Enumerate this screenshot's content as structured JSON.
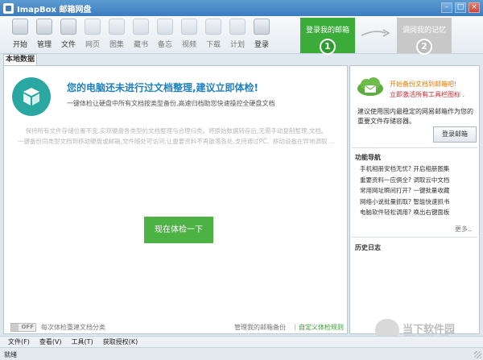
{
  "window": {
    "title": "ImapBox 邮箱网盘",
    "btn_min": "–",
    "btn_max": "□",
    "btn_close": "×"
  },
  "toolbar": {
    "items": [
      {
        "label": "开始",
        "icon": "home-icon"
      },
      {
        "label": "管理",
        "icon": "manage-icon"
      },
      {
        "label": "文件",
        "icon": "file-icon"
      },
      {
        "label": "网页",
        "icon": "webpage-icon"
      },
      {
        "label": "图集",
        "icon": "gallery-icon"
      },
      {
        "label": "藏书",
        "icon": "books-icon"
      },
      {
        "label": "备忘",
        "icon": "memo-icon"
      },
      {
        "label": "视频",
        "icon": "video-icon"
      },
      {
        "label": "下载",
        "icon": "download-icon"
      },
      {
        "label": "计划",
        "icon": "plan-icon"
      },
      {
        "label": "登录",
        "icon": "mail-server-icon"
      }
    ],
    "step1": {
      "label": "登录我的邮箱",
      "num": "1"
    },
    "step2": {
      "label": "调阅我的记忆",
      "num": "2"
    }
  },
  "tab": {
    "label": "本地数据"
  },
  "main": {
    "headline": "您的电脑还未进行过文档整理,建议立即体检!",
    "subline": "一键体检让硬盘中所有文档按类型备份,高速归档助您快速操控全硬盘文档",
    "desc_line1": "保持所有文件存储位置不变,实现硬盘各类型的文档整理与合理归类。将原始数据转存后,无需手动复制整理,文档。",
    "desc_line2": "一键备份同类型文档到移动硬盘或邮箱,文件随处可访问,让重要资料不再散落各处,支持通过PC、移动设备在异地调取 ...",
    "check_button": "现在体检一下",
    "toggle_state": "OFF",
    "toggle_label": "每次体检重建文档分类",
    "link_manage": "管理我的邮箱备份",
    "separator": "|",
    "link_rules": "自定义体检规则"
  },
  "right": {
    "line1": "开始备份文档到邮箱吧!",
    "line2": "立即激活所有工具栏图标 .",
    "desc": "建议使用国内最稳定的网易邮箱作为您的重要文件存储容器。",
    "login_button": "登录邮箱",
    "nav_title": "功能导航",
    "nav_items": [
      "手机相册安档无忧? 开启相册图集",
      "重要资料一应俱全? 调取云中文档",
      "常用网址瞬间打开? 一键批量收藏",
      "网络小说批量抓取? 智能快速抓书",
      "电脑软件轻松调用? 唤出右键面板"
    ],
    "more": "更多..",
    "history_title": "历史日志"
  },
  "watermark": {
    "text": "当下软件园",
    "url": "www.downxia.com"
  },
  "menubar": {
    "items": [
      "文件(F)",
      "查看(V)",
      "工具(T)",
      "获取授权(K)"
    ]
  },
  "status": {
    "text": "就绪"
  }
}
